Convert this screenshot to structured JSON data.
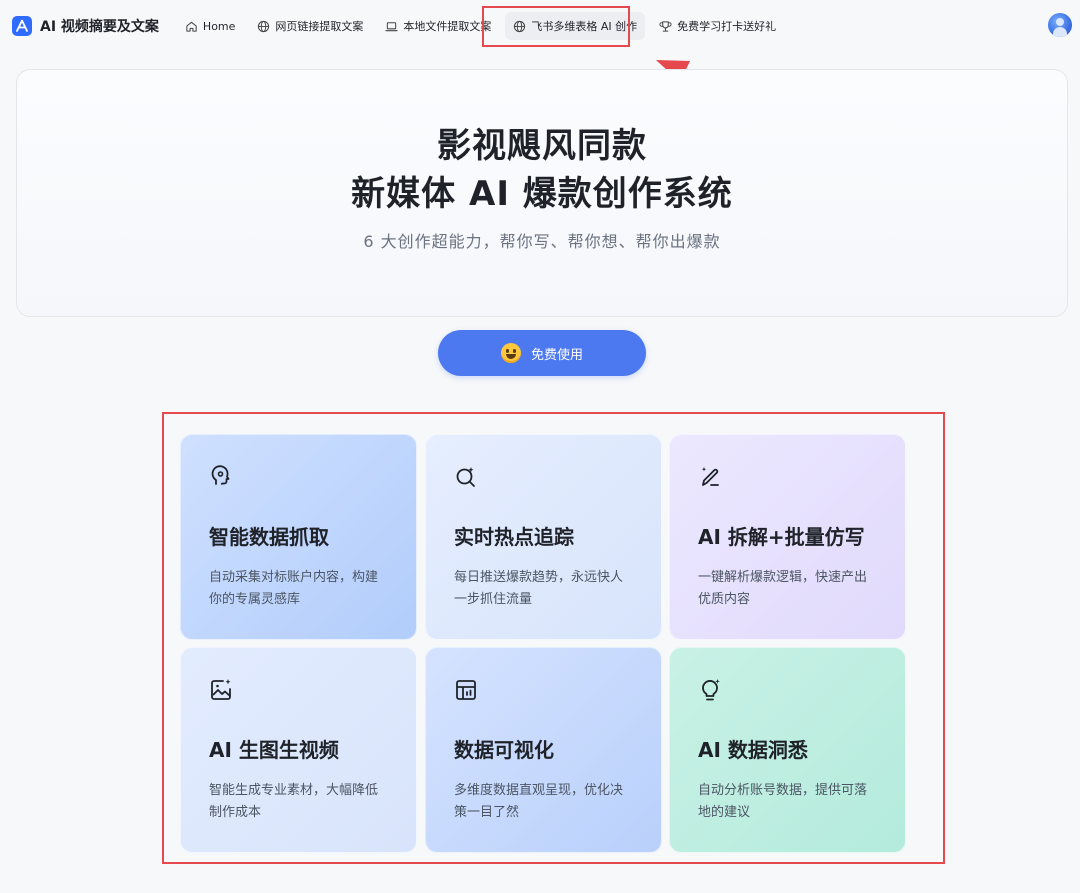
{
  "header": {
    "app_title": "AI 视频摘要及文案",
    "nav": [
      {
        "label": "Home",
        "icon": "home-icon"
      },
      {
        "label": "网页链接提取文案",
        "icon": "globe-icon"
      },
      {
        "label": "本地文件提取文案",
        "icon": "laptop-icon"
      },
      {
        "label": "飞书多维表格 AI 创作",
        "icon": "globe-icon",
        "active": true
      },
      {
        "label": "免费学习打卡送好礼",
        "icon": "trophy-icon"
      }
    ]
  },
  "hero": {
    "title_line1": "影视飓风同款",
    "title_line2": "新媒体 AI 爆款创作系统",
    "subtitle": "6 大创作超能力，帮你写、帮你想、帮你出爆款"
  },
  "cta": {
    "label": "免费使用",
    "icon": "smile-emoji-icon"
  },
  "features": [
    {
      "title": "智能数据抓取",
      "desc": "自动采集对标账户内容，构建你的专属灵感库",
      "icon": "brain-icon"
    },
    {
      "title": "实时热点追踪",
      "desc": "每日推送爆款趋势，永远快人一步抓住流量",
      "icon": "search-sparkle-icon"
    },
    {
      "title": "AI 拆解+批量仿写",
      "desc": "一键解析爆款逻辑，快速产出优质内容",
      "icon": "magic-pen-icon"
    },
    {
      "title": "AI 生图生视频",
      "desc": "智能生成专业素材，大幅降低制作成本",
      "icon": "image-sparkle-icon"
    },
    {
      "title": "数据可视化",
      "desc": "多维度数据直观呈现，优化决策一目了然",
      "icon": "table-chart-icon"
    },
    {
      "title": "AI 数据洞悉",
      "desc": "自动分析账号数据，提供可落地的建议",
      "icon": "lightbulb-icon"
    }
  ],
  "colors": {
    "accent": "#4d79f0",
    "highlight": "#e5484d"
  }
}
